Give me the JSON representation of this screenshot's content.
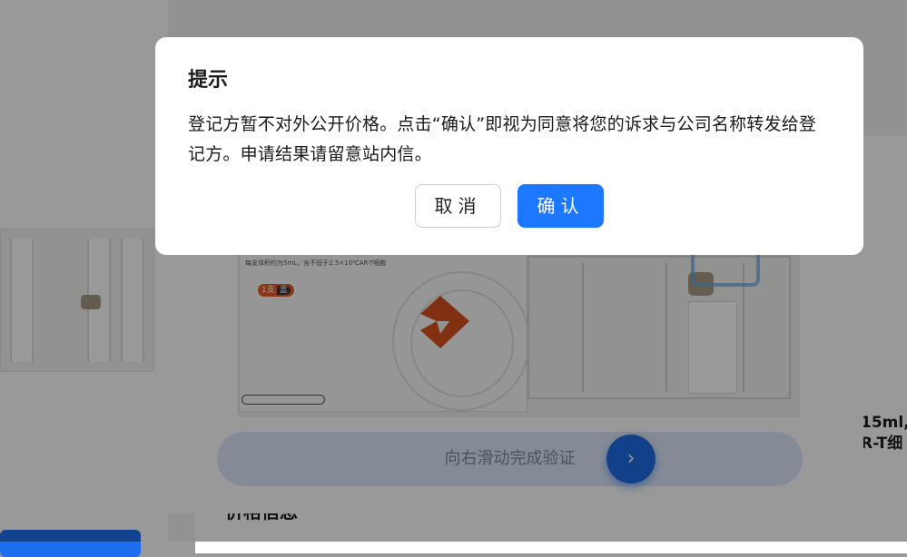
{
  "background": {
    "side_text_lines": [
      "15ml,",
      "R-T细"
    ],
    "section_title": "价格信息"
  },
  "captcha": {
    "package_text": "每支体积约为5mL，含不低于2.5×10⁸CAR-T细胞",
    "package_badge_count": "1支",
    "package_badge_unit": "盒",
    "slider_hint": "向右滑动完成验证",
    "slider_handle_glyph": "›"
  },
  "dialog": {
    "title": "提示",
    "message": "登记方暂不对外公开价格。点击“确认”即视为同意将您的诉求与公司名称转发给登记方。申请结果请留意站内信。",
    "cancel_label": "取消",
    "confirm_label": "确认"
  },
  "colors": {
    "primary": "#1c78ff",
    "overlay": "rgba(0,0,0,0.4)",
    "slider_track": "#dde8fb",
    "logo_orange": "#e85d2c"
  }
}
